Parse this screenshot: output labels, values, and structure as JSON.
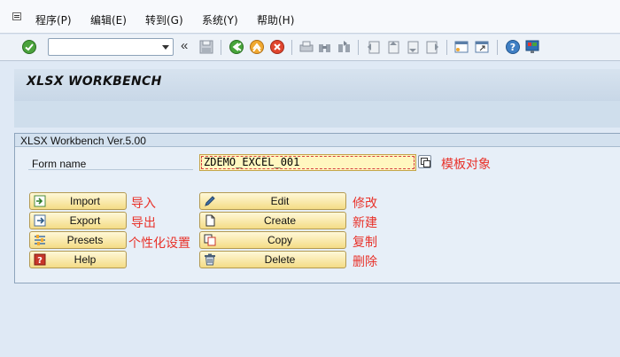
{
  "menu": {
    "items": [
      "程序(P)",
      "编辑(E)",
      "转到(G)",
      "系统(Y)",
      "帮助(H)"
    ]
  },
  "toolbar": {
    "command_value": "",
    "icons": [
      "enter-icon",
      "save-icon",
      "back-icon",
      "exit-icon",
      "cancel-icon",
      "print-icon",
      "find-icon",
      "find-next-icon",
      "first-page-icon",
      "previous-page-icon",
      "next-page-icon",
      "last-page-icon",
      "new-session-icon",
      "shortcut-icon",
      "help-icon",
      "customize-layout-icon"
    ],
    "history_glyph": "«"
  },
  "page": {
    "title": "XLSX WORKBENCH"
  },
  "group": {
    "title": "XLSX Workbench Ver.5.00"
  },
  "form": {
    "label": "Form name",
    "value": "ZDEMO_EXCEL_001",
    "annotation": "模板对象"
  },
  "buttons_left": [
    {
      "label": "Import",
      "icon": "import-icon",
      "annotation": "导入"
    },
    {
      "label": "Export",
      "icon": "export-icon",
      "annotation": "导出"
    },
    {
      "label": "Presets",
      "icon": "presets-icon",
      "annotation": "个性化设置"
    },
    {
      "label": "Help",
      "icon": "help-book-icon",
      "annotation": ""
    }
  ],
  "buttons_right": [
    {
      "label": "Edit",
      "icon": "pencil-icon",
      "annotation": "修改"
    },
    {
      "label": "Create",
      "icon": "new-document-icon",
      "annotation": "新建"
    },
    {
      "label": "Copy",
      "icon": "copy-icon",
      "annotation": "复制"
    },
    {
      "label": "Delete",
      "icon": "trash-icon",
      "annotation": "删除"
    }
  ],
  "colors": {
    "annotation": "#e8322a",
    "button_bg": "#f4dc86",
    "input_bg": "#fff7c0"
  }
}
